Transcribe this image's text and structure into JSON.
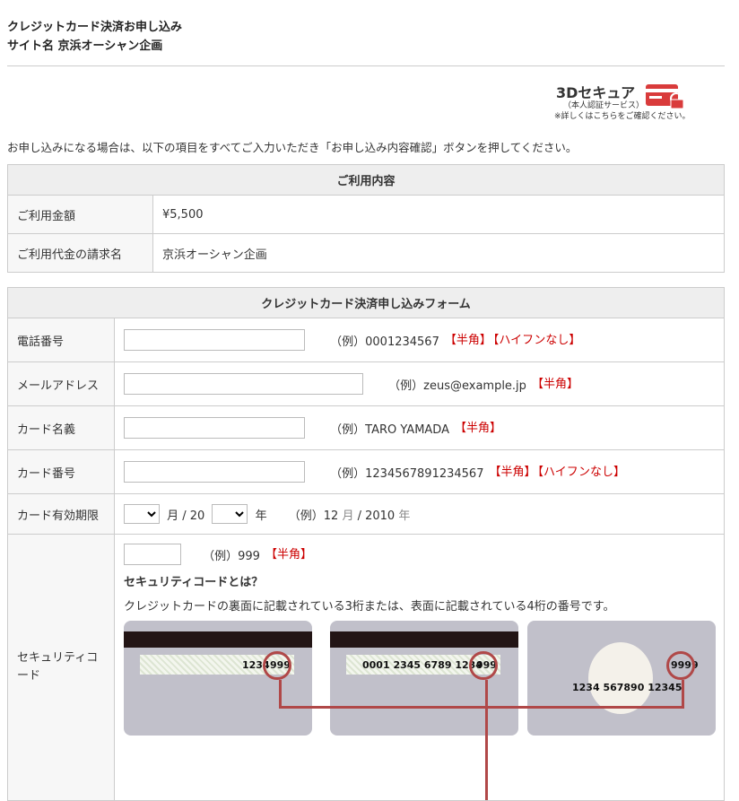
{
  "header": {
    "title": "クレジットカード決済お申し込み",
    "site_line": "サイト名 京浜オーシャン企画"
  },
  "secure_badge": {
    "title": "3Dセキュア",
    "subtitle": "（本人認証サービス）",
    "note": "※詳しくはこちらをご確認ください。"
  },
  "intro": "お申し込みになる場合は、以下の項目をすべてご入力いただき「お申し込み内容確認」ボタンを押してください。",
  "usage": {
    "caption": "ご利用内容",
    "rows": [
      {
        "label": "ご利用金額",
        "value": "¥5,500"
      },
      {
        "label": "ご利用代金の請求名",
        "value": "京浜オーシャン企画"
      }
    ]
  },
  "form": {
    "caption": "クレジットカード決済申し込みフォーム",
    "phone": {
      "label": "電話番号",
      "example": "（例）0001234567",
      "tag1": "【半角】",
      "tag2": "【ハイフンなし】",
      "value": ""
    },
    "email": {
      "label": "メールアドレス",
      "example": "（例）zeus@example.jp",
      "tag1": "【半角】",
      "value": ""
    },
    "card_name": {
      "label": "カード名義",
      "example": "（例）TARO YAMADA",
      "tag1": "【半角】",
      "value": ""
    },
    "card_number": {
      "label": "カード番号",
      "example": "（例）1234567891234567",
      "tag1": "【半角】",
      "tag2": "【ハイフンなし】",
      "value": ""
    },
    "expiry": {
      "label": "カード有効期限",
      "month_unit": "月 / 20",
      "year_unit": "年",
      "example_prefix": "（例）12",
      "example_month": "月",
      "example_sep": "/ 2010",
      "example_year": "年"
    },
    "security": {
      "label": "セキュリティコード",
      "example": "（例）999",
      "tag1": "【半角】",
      "title": "セキュリティコードとは？",
      "desc": "クレジットカードの裏面に記載されている3桁または、表面に記載されている4桁の番号です。",
      "card1_digits": "1234",
      "card1_code": "999",
      "card2_digits": "0001  2345  6789  1234",
      "card2_code": "999",
      "card3_code": "9999",
      "card3_number": "1234  567890  12345"
    }
  },
  "colors": {
    "accent_red": "#cc0000",
    "circle": "#b04848",
    "header_bg": "#eeeeee"
  }
}
